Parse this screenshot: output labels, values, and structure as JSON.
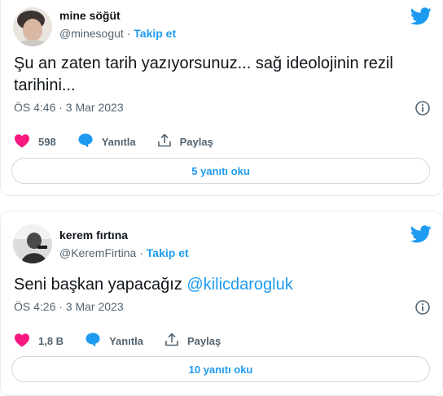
{
  "tweets": [
    {
      "name": "mine söğüt",
      "handle": "@minesogut",
      "separator": "·",
      "follow_label": "Takip et",
      "text": "Şu an zaten tarih yazıyorsunuz... sağ ideolojinin rezil tarihini...",
      "timestamp": "ÖS 4:46 · 3 Mar 2023",
      "like_count": "598",
      "reply_label": "Yanıtla",
      "share_label": "Paylaş",
      "read_replies_label": "5 yanıtı oku",
      "icons": {
        "logo": "twitter-bird-icon",
        "info": "info-icon",
        "like": "heart-icon",
        "reply": "speech-bubble-icon",
        "share": "share-icon"
      }
    },
    {
      "name": "kerem fırtına",
      "handle": "@KeremFirtina",
      "separator": "·",
      "follow_label": "Takip et",
      "text_prefix": "Seni başkan yapacağız ",
      "text_mention": "@kilicdarogluk",
      "timestamp": "ÖS 4:26 · 3 Mar 2023",
      "like_count": "1,8 B",
      "reply_label": "Yanıtla",
      "share_label": "Paylaş",
      "read_replies_label": "10 yanıtı oku",
      "icons": {
        "logo": "twitter-bird-icon",
        "info": "info-icon",
        "like": "heart-icon",
        "reply": "speech-bubble-icon",
        "share": "share-icon"
      }
    }
  ],
  "colors": {
    "accent": "#1d9bf0",
    "like": "#f91880",
    "muted": "#536471",
    "text": "#0f1419",
    "border": "#cfd9de"
  }
}
